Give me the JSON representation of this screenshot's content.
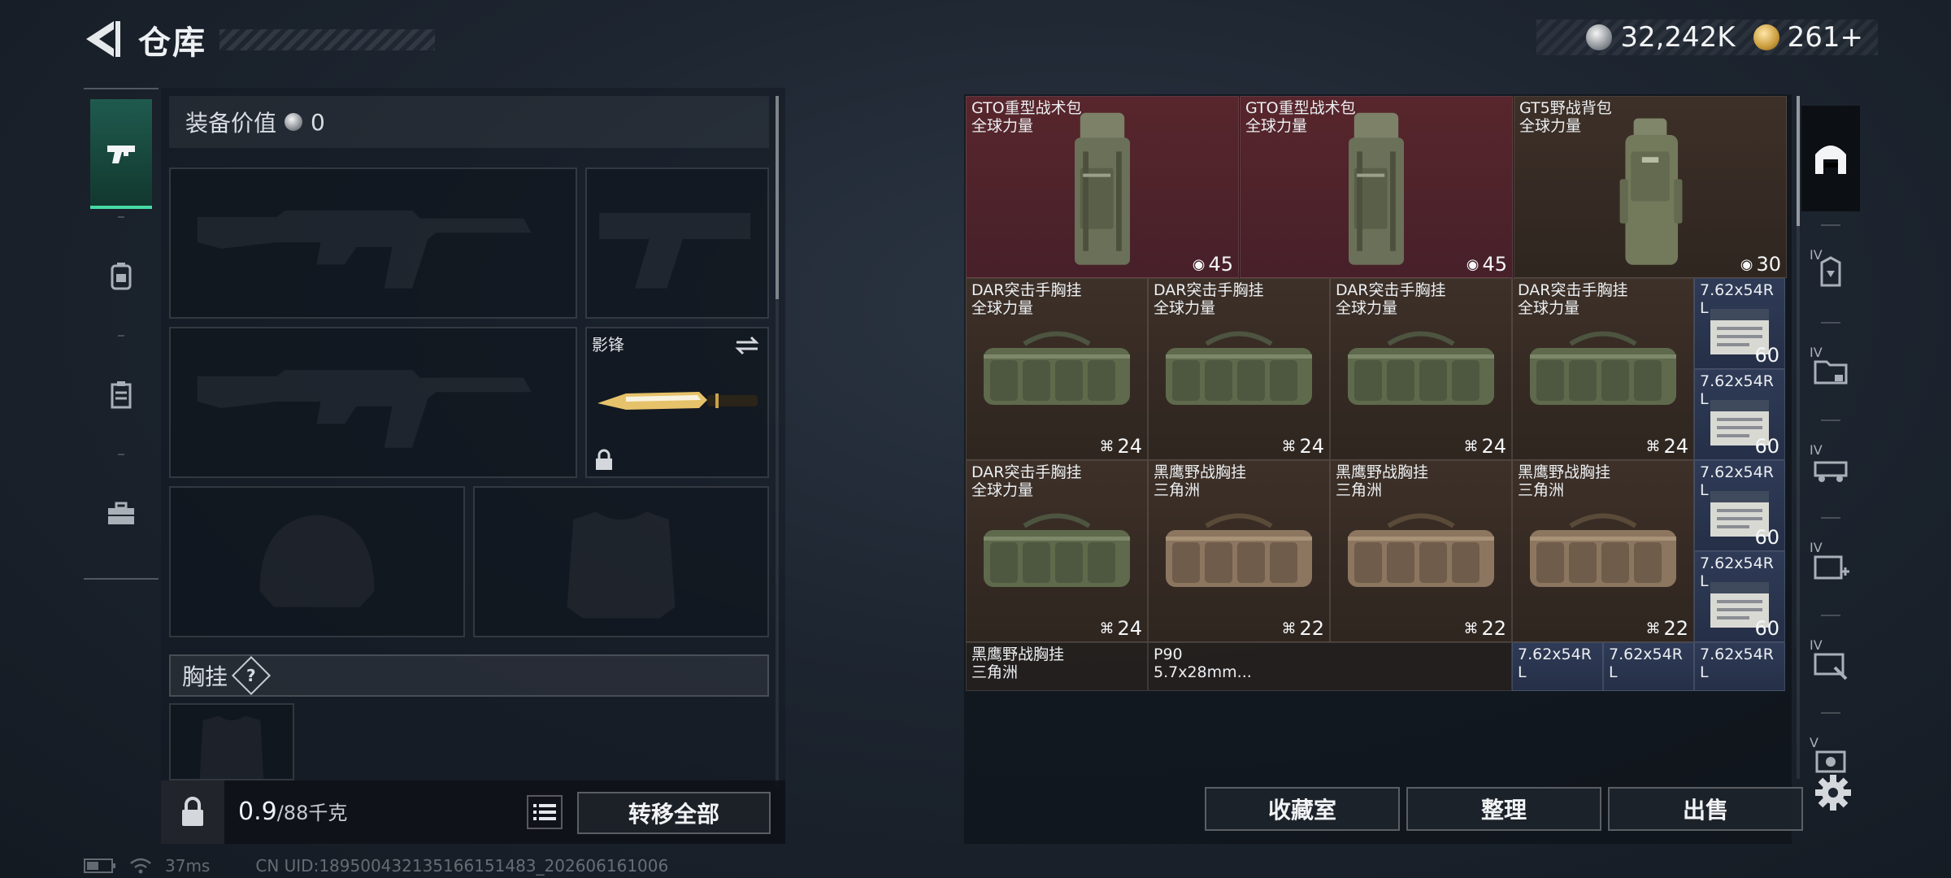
{
  "header": {
    "title": "仓库",
    "currency_silver": "32,242K",
    "currency_gold": "261+"
  },
  "tabs": [
    {
      "id": "weapons",
      "icon": "pistol-icon",
      "active": true
    },
    {
      "id": "armor",
      "icon": "backpack-icon",
      "active": false
    },
    {
      "id": "containers",
      "icon": "case-icon",
      "active": false
    },
    {
      "id": "tools",
      "icon": "toolbox-icon",
      "active": false
    }
  ],
  "equipment": {
    "value_label": "装备价值",
    "value": "0",
    "melee_slot_label": "影锋",
    "vest_label": "胸挂",
    "help_symbol": "?",
    "weight_current": "0.9",
    "weight_max": "/88千克",
    "transfer_all": "转移全部"
  },
  "storage": {
    "items": [
      {
        "name": "GTO重型战术包",
        "sub": "全球力量",
        "count": "45",
        "kind": "backpack-tall",
        "color": "red"
      },
      {
        "name": "GTO重型战术包",
        "sub": "全球力量",
        "count": "45",
        "kind": "backpack-tall",
        "color": "red"
      },
      {
        "name": "GT5野战背包",
        "sub": "全球力量",
        "count": "30",
        "kind": "backpack-frame",
        "color": "brown"
      },
      {
        "name": "DAR突击手胸挂",
        "sub": "全球力量",
        "count": "24",
        "kind": "rig-green",
        "color": "brown"
      },
      {
        "name": "DAR突击手胸挂",
        "sub": "全球力量",
        "count": "24",
        "kind": "rig-green",
        "color": "brown"
      },
      {
        "name": "DAR突击手胸挂",
        "sub": "全球力量",
        "count": "24",
        "kind": "rig-green",
        "color": "brown"
      },
      {
        "name": "DAR突击手胸挂",
        "sub": "全球力量",
        "count": "24",
        "kind": "rig-green",
        "color": "brown"
      },
      {
        "name": "DAR突击手胸挂",
        "sub": "全球力量",
        "count": "24",
        "kind": "rig-green",
        "color": "brown"
      },
      {
        "name": "黑鹰野战胸挂",
        "sub": "三角洲",
        "count": "22",
        "kind": "rig-tan",
        "color": "brown"
      },
      {
        "name": "黑鹰野战胸挂",
        "sub": "三角洲",
        "count": "22",
        "kind": "rig-tan",
        "color": "brown"
      },
      {
        "name": "黑鹰野战胸挂",
        "sub": "三角洲",
        "count": "22",
        "kind": "rig-tan",
        "color": "brown"
      },
      {
        "name": "黑鹰野战胸挂",
        "sub": "三角洲",
        "count": "",
        "kind": "rig-tan",
        "color": "dark"
      },
      {
        "name": "P90",
        "sub": "5.7x28mm...",
        "count": "",
        "kind": "ammo-p90",
        "color": "dark"
      }
    ],
    "ammo": [
      {
        "name": "7.62x54R",
        "sub": "L",
        "count": "60"
      },
      {
        "name": "7.62x54R",
        "sub": "L",
        "count": "60"
      },
      {
        "name": "7.62x54R",
        "sub": "L",
        "count": "60"
      },
      {
        "name": "7.62x54R",
        "sub": "L",
        "count": "60"
      },
      {
        "name": "7.62x54R",
        "sub": "L",
        "count": ""
      },
      {
        "name": "7.62x54R",
        "sub": "L",
        "count": ""
      },
      {
        "name": "7.62x54R",
        "sub": "L",
        "count": ""
      }
    ],
    "vault": "收藏室",
    "sort": "整理",
    "sell": "出售"
  },
  "filters": [
    {
      "icon": "arch-icon",
      "active": true
    },
    {
      "icon": "filter-armor-icon",
      "badge": "IV"
    },
    {
      "icon": "filter-folder-icon",
      "badge": "IV"
    },
    {
      "icon": "filter-vehicle-icon",
      "badge": "IV"
    },
    {
      "icon": "filter-medkit-icon",
      "badge": "IV"
    },
    {
      "icon": "filter-tool-icon",
      "badge": "IV"
    },
    {
      "icon": "filter-camera-icon",
      "badge": "V"
    }
  ],
  "footer": {
    "ping": "37ms",
    "uid": "CN UID:18950043213516615148​3_202606161006"
  },
  "colors": {
    "accent": "#47d9a5",
    "cell_red": "#58262c",
    "cell_brown": "#3d3028",
    "cell_blue": "#2f3b57"
  }
}
